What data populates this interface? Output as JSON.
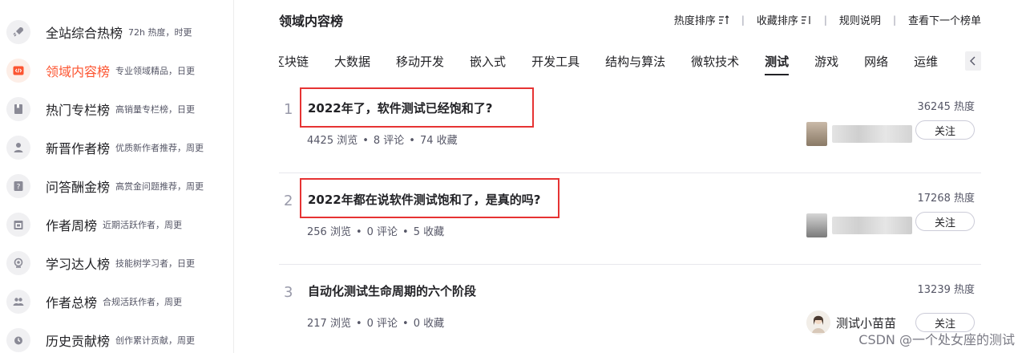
{
  "sidebar": {
    "items": [
      {
        "label": "全站综合热榜",
        "desc": "72h 热度，时更",
        "icon": "rocket-icon"
      },
      {
        "label": "领域内容榜",
        "desc": "专业领域精品，日更",
        "icon": "code-icon",
        "active": true
      },
      {
        "label": "热门专栏榜",
        "desc": "高销量专栏榜，日更",
        "icon": "bookmark-icon"
      },
      {
        "label": "新晋作者榜",
        "desc": "优质新作者推荐，周更",
        "icon": "user-icon"
      },
      {
        "label": "问答酬金榜",
        "desc": "高赏金问题推荐，周更",
        "icon": "question-icon"
      },
      {
        "label": "作者周榜",
        "desc": "近期活跃作者，周更",
        "icon": "calendar-icon"
      },
      {
        "label": "学习达人榜",
        "desc": "技能树学习者，日更",
        "icon": "learner-icon"
      },
      {
        "label": "作者总榜",
        "desc": "合规活跃作者，周更",
        "icon": "group-icon"
      },
      {
        "label": "历史贡献榜",
        "desc": "创作累计贡献，周更",
        "icon": "history-icon"
      }
    ]
  },
  "header": {
    "title": "领域内容榜",
    "links": [
      "热度排序",
      "收藏排序",
      "规则说明",
      "查看下一个榜单"
    ]
  },
  "tabs": {
    "items": [
      "区块链",
      "大数据",
      "移动开发",
      "嵌入式",
      "开发工具",
      "结构与算法",
      "微软技术",
      "测试",
      "游戏",
      "网络",
      "运维"
    ],
    "active": "测试"
  },
  "articles": [
    {
      "rank": "1",
      "title": "2022年了，软件测试已经饱和了?",
      "views": "4425 浏览",
      "comments": "8 评论",
      "favorites": "74 收藏",
      "heat": "36245 热度",
      "follow": "关注",
      "highlighted": true
    },
    {
      "rank": "2",
      "title": "2022年都在说软件测试饱和了，是真的吗?",
      "views": "256 浏览",
      "comments": "0 评论",
      "favorites": "5 收藏",
      "heat": "17268 热度",
      "follow": "关注",
      "highlighted": true
    },
    {
      "rank": "3",
      "title": "自动化测试生命周期的六个阶段",
      "views": "217 浏览",
      "comments": "0 评论",
      "favorites": "0 收藏",
      "heat": "13239 热度",
      "follow": "关注",
      "author": "测试小苗苗",
      "highlighted": false
    }
  ],
  "stat_separator": "•",
  "watermark": "CSDN @一个处女座的测试",
  "colors": {
    "accent": "#fc5531",
    "highlight_box": "#e63333",
    "text": "#222226",
    "muted": "#555666"
  }
}
